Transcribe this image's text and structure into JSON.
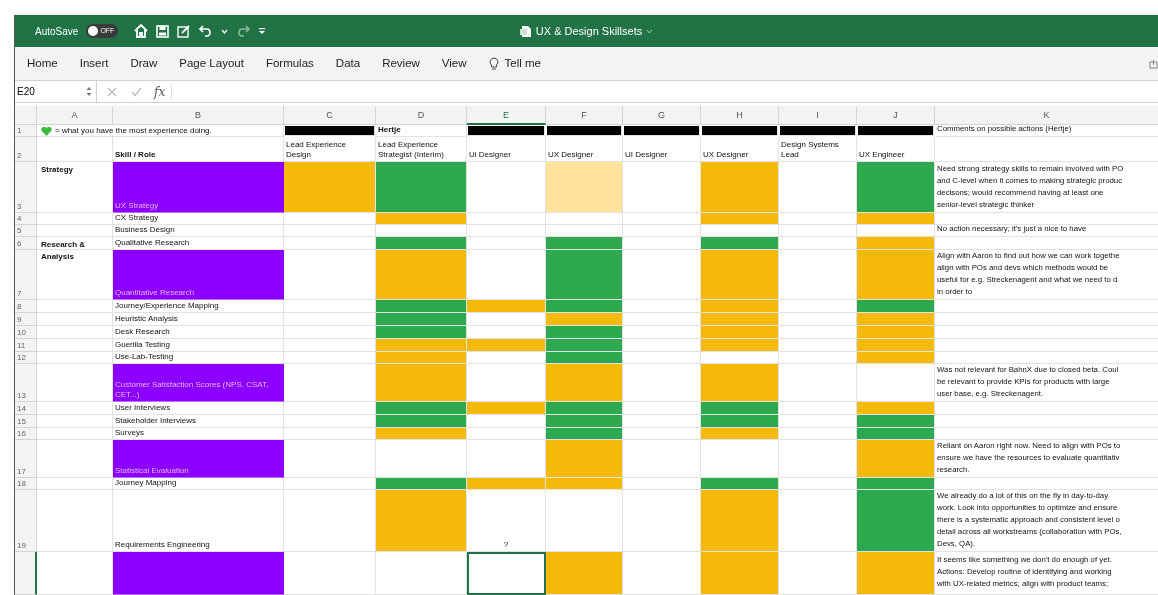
{
  "titlebar": {
    "autosave_label": "AutoSave",
    "autosave_on": false,
    "toggle_text": "OFF",
    "title": "UX & Design Skillsets"
  },
  "ribbon_tabs": [
    {
      "label": "Home",
      "kind": "text"
    },
    {
      "label": "Insert",
      "kind": "text"
    },
    {
      "label": "Draw",
      "kind": "text"
    },
    {
      "label": "Page Layout",
      "kind": "text"
    },
    {
      "label": "Formulas",
      "kind": "text"
    },
    {
      "label": "Data",
      "kind": "text"
    },
    {
      "label": "Review",
      "kind": "text"
    },
    {
      "label": "View",
      "kind": "text"
    },
    {
      "label": "Tell me",
      "kind": "search"
    }
  ],
  "formula_bar": {
    "name_box": "E20",
    "function_label": "fx"
  },
  "columns": [
    {
      "label": "A",
      "selected": false
    },
    {
      "label": "B",
      "selected": false
    },
    {
      "label": "C",
      "selected": false
    },
    {
      "label": "D",
      "selected": false
    },
    {
      "label": "E",
      "selected": true
    },
    {
      "label": "F",
      "selected": false
    },
    {
      "label": "G",
      "selected": false
    },
    {
      "label": "H",
      "selected": false
    },
    {
      "label": "I",
      "selected": false
    },
    {
      "label": "J",
      "selected": false
    },
    {
      "label": "K",
      "selected": false
    }
  ],
  "rows": [
    {
      "kind": "legend",
      "number": "1",
      "selected": false,
      "legend": "= what you have the most experience doing.",
      "cells": [
        {
          "color": "#000000"
        },
        {
          "text": "Hertje"
        },
        {
          "color": "#000000"
        },
        {
          "color": "#000000"
        },
        {
          "color": "#000000"
        },
        {
          "color": "#000000"
        },
        {
          "color": "#000000"
        },
        {
          "color": "#000000"
        }
      ],
      "comment": "Comments on possible actions (Hertje)"
    },
    {
      "kind": "header",
      "number": "2",
      "selected": false,
      "skill": "Skill / Role",
      "cells": [
        {
          "text": "Lead Experience Design"
        },
        {
          "text": "Lead Experience Strategist (Interim)"
        },
        {
          "text": "Ui Designer"
        },
        {
          "text": "UX Designer"
        },
        {
          "text": "UI Designer"
        },
        {
          "text": "UX Designer"
        },
        {
          "text": "Design Systems Lead"
        },
        {
          "text": "UX Engineer"
        }
      ]
    },
    {
      "kind": "skill",
      "number": "3",
      "selected": false,
      "group": "Strategy",
      "skill": "UX Strategy",
      "highlighted": true,
      "cells": [
        {
          "color": "#f5b90a"
        },
        {
          "color": "#2ea84f"
        },
        {},
        {
          "color": "#fde49a"
        },
        {},
        {
          "color": "#f5b90a"
        },
        {},
        {
          "color": "#2ea84f"
        }
      ],
      "comment": "Need strong strategy skills to remain involved with PO\nand C-level when it comes to making strategic produc\ndecisons; would recommend having at least one\nsenior-level strategic thinker"
    },
    {
      "kind": "skill",
      "number": "4",
      "selected": false,
      "skill": "CX Strategy",
      "highlighted": false,
      "cells": [
        {},
        {
          "color": "#f5b90a"
        },
        {},
        {},
        {},
        {
          "color": "#f5b90a"
        },
        {},
        {
          "color": "#f5b90a"
        }
      ]
    },
    {
      "kind": "skill",
      "number": "5",
      "selected": false,
      "skill": "Business Design",
      "highlighted": false,
      "cells": [
        {},
        {},
        {},
        {},
        {},
        {},
        {},
        {}
      ],
      "comment": "No action necessary; it's just a nice to have"
    },
    {
      "kind": "skill",
      "number": "6",
      "selected": false,
      "group": "Research & Analysis",
      "skill": "Qualitative Research",
      "highlighted": false,
      "cells": [
        {},
        {
          "color": "#2ea84f"
        },
        {},
        {
          "color": "#2ea84f"
        },
        {},
        {
          "color": "#2ea84f"
        },
        {},
        {
          "color": "#f5b90a"
        }
      ]
    },
    {
      "kind": "skill",
      "number": "7",
      "selected": false,
      "skill": "Quantitative Research",
      "highlighted": true,
      "cells": [
        {},
        {
          "color": "#f5b90a"
        },
        {},
        {
          "color": "#2ea84f"
        },
        {},
        {
          "color": "#f5b90a"
        },
        {},
        {
          "color": "#f5b90a"
        }
      ],
      "comment": "Align with Aaron to find out how we can work togethe\nalign with POs and devs which methods would be\nuseful for e.g. Streckenagent and what we need to d\nin order to"
    },
    {
      "kind": "skill",
      "number": "8",
      "selected": false,
      "skill": "Journey/Experience Mapping",
      "highlighted": false,
      "cells": [
        {},
        {
          "color": "#2ea84f"
        },
        {
          "color": "#f5b90a"
        },
        {
          "color": "#2ea84f"
        },
        {},
        {
          "color": "#f5b90a"
        },
        {},
        {
          "color": "#2ea84f"
        }
      ]
    },
    {
      "kind": "skill",
      "number": "9",
      "selected": false,
      "skill": "Heuristic Analysis",
      "highlighted": false,
      "cells": [
        {},
        {
          "color": "#2ea84f"
        },
        {},
        {
          "color": "#f5b90a"
        },
        {},
        {
          "color": "#f5b90a"
        },
        {},
        {
          "color": "#f5b90a"
        }
      ]
    },
    {
      "kind": "skill",
      "number": "10",
      "selected": false,
      "skill": "Desk Research",
      "highlighted": false,
      "cells": [
        {},
        {
          "color": "#2ea84f"
        },
        {},
        {
          "color": "#2ea84f"
        },
        {},
        {
          "color": "#f5b90a"
        },
        {},
        {
          "color": "#f5b90a"
        }
      ]
    },
    {
      "kind": "skill",
      "number": "11",
      "selected": false,
      "skill": "Guerilla Testing",
      "highlighted": false,
      "cells": [
        {},
        {
          "color": "#f5b90a"
        },
        {
          "color": "#f5b90a"
        },
        {
          "color": "#2ea84f"
        },
        {},
        {
          "color": "#f5b90a"
        },
        {},
        {
          "color": "#f5b90a"
        }
      ]
    },
    {
      "kind": "skill",
      "number": "12",
      "selected": false,
      "skill": "Use-Lab-Testing",
      "highlighted": false,
      "cells": [
        {},
        {
          "color": "#f5b90a"
        },
        {},
        {
          "color": "#2ea84f"
        },
        {},
        {},
        {},
        {
          "color": "#f5b90a"
        }
      ]
    },
    {
      "kind": "skill",
      "number": "13",
      "selected": false,
      "skill": "Customer Satisfaction Scores (NPS, CSAT, CET...)",
      "highlighted": true,
      "cells": [
        {},
        {
          "color": "#f5b90a"
        },
        {},
        {
          "color": "#f5b90a"
        },
        {},
        {
          "color": "#f5b90a"
        },
        {},
        {}
      ],
      "comment": "Was not relevant for BahnX due to closed beta. Coul\nbe relevant to provide KPIs for products with large\nuser base, e.g. Streckenagent."
    },
    {
      "kind": "skill",
      "number": "14",
      "selected": false,
      "skill": "User Interviews",
      "highlighted": false,
      "cells": [
        {},
        {
          "color": "#2ea84f"
        },
        {
          "color": "#f5b90a"
        },
        {
          "color": "#2ea84f"
        },
        {},
        {
          "color": "#2ea84f"
        },
        {},
        {
          "color": "#f5b90a"
        }
      ]
    },
    {
      "kind": "skill",
      "number": "15",
      "selected": false,
      "skill": "Stakeholder Interviews",
      "highlighted": false,
      "cells": [
        {},
        {
          "color": "#2ea84f"
        },
        {},
        {
          "color": "#2ea84f"
        },
        {},
        {
          "color": "#2ea84f"
        },
        {},
        {
          "color": "#2ea84f"
        }
      ]
    },
    {
      "kind": "skill",
      "number": "16",
      "selected": false,
      "skill": "Surveys",
      "highlighted": false,
      "cells": [
        {},
        {
          "color": "#f5b90a"
        },
        {},
        {
          "color": "#2ea84f"
        },
        {},
        {
          "color": "#f5b90a"
        },
        {},
        {
          "color": "#2ea84f"
        }
      ]
    },
    {
      "kind": "skill",
      "number": "17",
      "selected": false,
      "skill": "Statistical Evaluation",
      "highlighted": true,
      "cells": [
        {},
        {},
        {},
        {
          "color": "#f5b90a"
        },
        {},
        {},
        {},
        {
          "color": "#f5b90a"
        }
      ],
      "comment": "Reliant on Aaron right now. Need to align with POs to\nensure we have the resources to evaluate quantitativ\nresearch."
    },
    {
      "kind": "skill",
      "number": "18",
      "selected": false,
      "skill": "Journey Mapping",
      "highlighted": false,
      "cells": [
        {},
        {
          "color": "#2ea84f"
        },
        {
          "color": "#f5b90a"
        },
        {
          "color": "#f5b90a"
        },
        {},
        {
          "color": "#2ea84f"
        },
        {},
        {
          "color": "#2ea84f"
        }
      ]
    },
    {
      "kind": "skill",
      "number": "19",
      "selected": false,
      "skill": "Requirements Engineering",
      "highlighted": false,
      "cells": [
        {},
        {
          "color": "#f5b90a"
        },
        {
          "text": "?"
        },
        {},
        {},
        {
          "color": "#f5b90a"
        },
        {},
        {
          "color": "#2ea84f"
        }
      ],
      "comment": "We already do a lot of this on the fly in day-to-day\nwork. Look into opportunities to optimize and ensure\nthere is a systematic approach and consistent level o\ndetail across all workstreams (collaboration with POs,\nDevs, QA)."
    },
    {
      "kind": "skill",
      "selected": true,
      "highlighted": true,
      "cells": [
        {},
        {},
        {},
        {
          "color": "#f5b90a"
        },
        {},
        {
          "color": "#f5b90a"
        },
        {},
        {
          "color": "#f5b90a"
        }
      ],
      "comment": "It seems like something we don't do enough of yet.\nActions: Develop routine of identifying and working\nwith UX-related metrics; align with product teams;"
    }
  ]
}
